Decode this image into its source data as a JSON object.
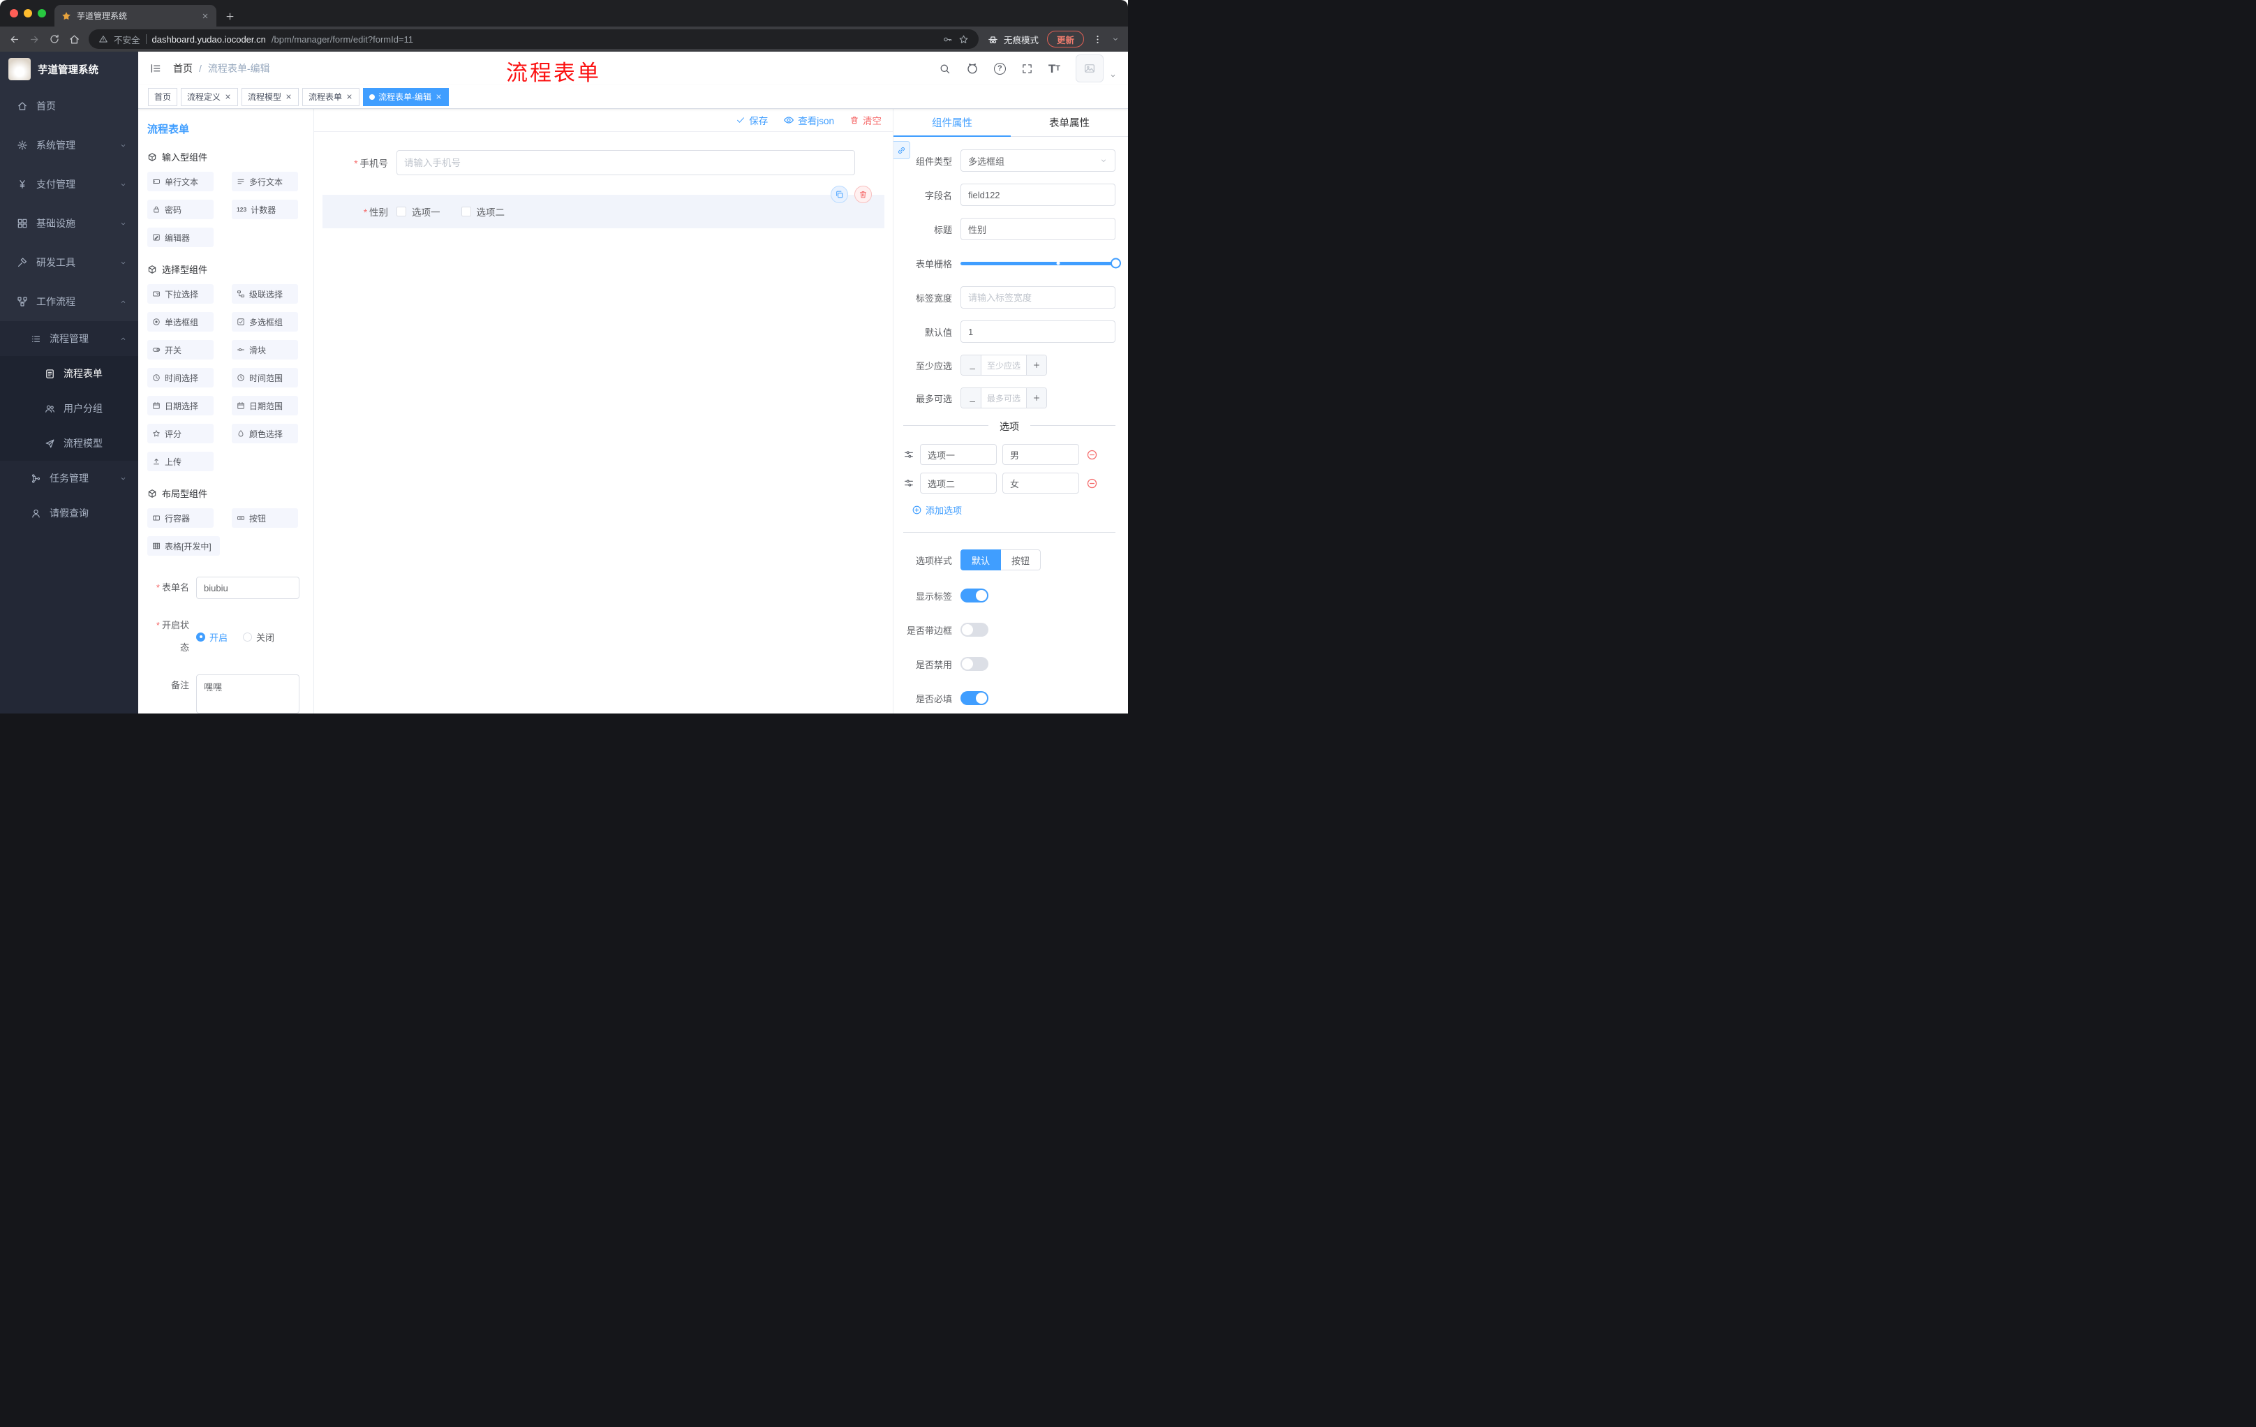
{
  "browser": {
    "tab_title": "芋道管理系统",
    "security": "不安全",
    "url_host": "dashboard.yudao.iocoder.cn",
    "url_path": "/bpm/manager/form/edit?formId=11",
    "incognito": "无痕模式",
    "update": "更新"
  },
  "sidebar": {
    "logo": "芋道管理系统",
    "items": [
      {
        "label": "首页"
      },
      {
        "label": "系统管理"
      },
      {
        "label": "支付管理"
      },
      {
        "label": "基础设施"
      },
      {
        "label": "研发工具"
      },
      {
        "label": "工作流程"
      },
      {
        "label": "流程管理"
      },
      {
        "label": "流程表单"
      },
      {
        "label": "用户分组"
      },
      {
        "label": "流程模型"
      },
      {
        "label": "任务管理"
      },
      {
        "label": "请假查询"
      }
    ]
  },
  "header": {
    "breadcrumb_home": "首页",
    "breadcrumb_sep": "/",
    "breadcrumb_current": "流程表单-编辑",
    "annotation": "流程表单"
  },
  "tags": {
    "items": [
      {
        "label": "首页"
      },
      {
        "label": "流程定义"
      },
      {
        "label": "流程模型"
      },
      {
        "label": "流程表单"
      },
      {
        "label": "流程表单-编辑"
      }
    ]
  },
  "designer": {
    "panel_title": "流程表单",
    "toolbar": {
      "save": "保存",
      "view_json": "查看json",
      "clear": "清空"
    },
    "palette": {
      "counter_icon_text": "123",
      "sections": [
        {
          "title": "输入型组件",
          "items": [
            {
              "label": "单行文本"
            },
            {
              "label": "多行文本"
            },
            {
              "label": "密码"
            },
            {
              "label": "计数器"
            },
            {
              "label": "编辑器"
            }
          ]
        },
        {
          "title": "选择型组件",
          "items": [
            {
              "label": "下拉选择"
            },
            {
              "label": "级联选择"
            },
            {
              "label": "单选框组"
            },
            {
              "label": "多选框组"
            },
            {
              "label": "开关"
            },
            {
              "label": "滑块"
            },
            {
              "label": "时间选择"
            },
            {
              "label": "时间范围"
            },
            {
              "label": "日期选择"
            },
            {
              "label": "日期范围"
            },
            {
              "label": "评分"
            },
            {
              "label": "颜色选择"
            },
            {
              "label": "上传"
            }
          ]
        },
        {
          "title": "布局型组件",
          "items": [
            {
              "label": "行容器"
            },
            {
              "label": "按钮"
            },
            {
              "label": "表格[开发中]"
            }
          ]
        }
      ]
    },
    "meta": {
      "name_label": "表单名",
      "name_value": "biubiu",
      "status_label": "开启状态",
      "status_on": "开启",
      "status_off": "关闭",
      "remark_label": "备注",
      "remark_value": "嘿嘿"
    },
    "canvas": {
      "phone_label": "手机号",
      "phone_placeholder": "请输入手机号",
      "gender_label": "性别",
      "gender_options": [
        {
          "label": "选项一"
        },
        {
          "label": "选项二"
        }
      ]
    }
  },
  "properties": {
    "tab_component": "组件属性",
    "tab_form": "表单属性",
    "rows": {
      "comp_type_label": "组件类型",
      "comp_type_value": "多选框组",
      "field_label": "字段名",
      "field_value": "field122",
      "title_label": "标题",
      "title_value": "性别",
      "grid_label": "表单栅格",
      "label_width_label": "标签宽度",
      "label_width_placeholder": "请输入标签宽度",
      "default_label": "默认值",
      "default_value": "1",
      "min_label": "至少应选",
      "min_placeholder": "至少应选",
      "max_label": "最多可选",
      "max_placeholder": "最多可选"
    },
    "options": {
      "title": "选项",
      "list": [
        {
          "label": "选项一",
          "value": "男"
        },
        {
          "label": "选项二",
          "value": "女"
        }
      ],
      "add": "添加选项"
    },
    "style": {
      "label": "选项样式",
      "default": "默认",
      "button": "按钮"
    },
    "toggles": [
      {
        "label": "显示标签",
        "on": true
      },
      {
        "label": "是否带边框",
        "on": false
      },
      {
        "label": "是否禁用",
        "on": false
      },
      {
        "label": "是否必填",
        "on": true
      }
    ]
  },
  "icons": {
    "question": "?",
    "fontsize_big": "T",
    "fontsize_small": "T"
  },
  "colors": {
    "accent": "#409eff",
    "danger": "#f56c6c",
    "annotation": "#ff0000",
    "sidebar": "#2b303e",
    "selected_row": "#f1f4fb"
  }
}
